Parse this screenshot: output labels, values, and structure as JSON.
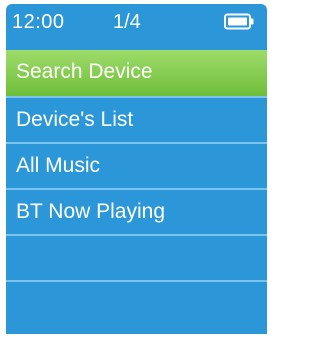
{
  "status": {
    "time": "12:00",
    "page": "1/4",
    "battery_icon": "battery-full-icon"
  },
  "menu": {
    "items": [
      {
        "label": "Search Device",
        "selected": true
      },
      {
        "label": "Device's List",
        "selected": false
      },
      {
        "label": "All Music",
        "selected": false
      },
      {
        "label": "BT Now Playing",
        "selected": false
      }
    ]
  },
  "colors": {
    "background": "#2b97d8",
    "divider": "#7cc3ee",
    "highlight": "#7cc84a",
    "text": "#ffffff"
  }
}
